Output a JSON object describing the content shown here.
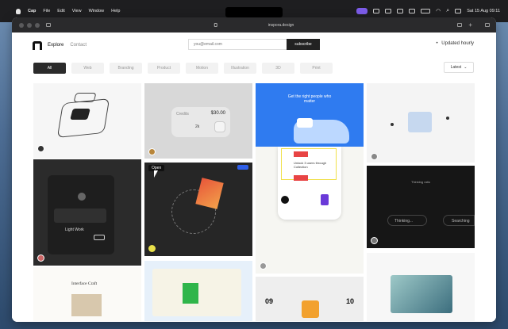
{
  "menubar": {
    "app": "Cap",
    "items": [
      "File",
      "Edit",
      "View",
      "Window",
      "Help"
    ],
    "datetime": "Sat 15 Aug 09:11"
  },
  "browser": {
    "url": "inspora.design"
  },
  "site": {
    "nav": [
      "Explore",
      "Contact"
    ],
    "email_placeholder": "you@email.com",
    "subscribe": "subscribe",
    "updated": "Updated hourly",
    "filters": [
      "All",
      "Web",
      "Branding",
      "Product",
      "Motion",
      "Illustration",
      "3D",
      "Print"
    ],
    "sort": "Latest"
  },
  "cards": {
    "credits": {
      "label": "Credits",
      "amount": "$30.00",
      "count": "2k"
    },
    "blue": {
      "headline": "Get the right people who matter"
    },
    "light_work": {
      "title": "Light Work"
    },
    "cta_badge": "Open",
    "unlock": {
      "title": "Unlock 3 users through Collection"
    },
    "thinking": {
      "title": "Thinking ratio",
      "status": "Thinking...",
      "searching": "Searching"
    },
    "interface_craft": {
      "title": "Interface Craft"
    },
    "date": {
      "left": "09",
      "right": "10"
    }
  },
  "colors": {
    "accent": "#2f7bf0",
    "subscribe": "#222222",
    "chip_active": "#2b2b2b"
  }
}
